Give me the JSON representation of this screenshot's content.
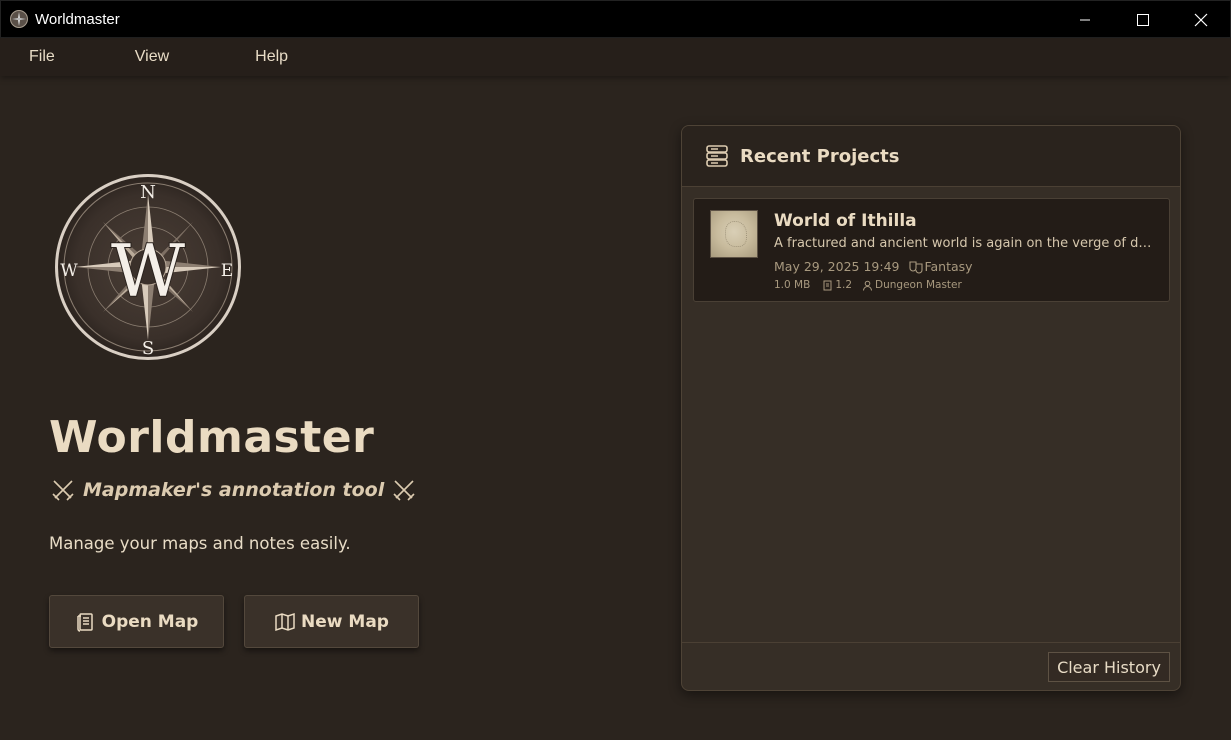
{
  "window": {
    "title": "Worldmaster",
    "icon": "compass-icon",
    "controls": [
      "minimize-icon",
      "maximize-icon",
      "close-icon"
    ]
  },
  "menu": {
    "items": [
      {
        "label": "File"
      },
      {
        "label": "View"
      },
      {
        "label": "Help"
      }
    ]
  },
  "hero": {
    "logo_icon": "compass-rose-icon",
    "compass_letters": {
      "n": "N",
      "s": "S",
      "e": "E",
      "w": "W",
      "center": "W"
    },
    "title": "Worldmaster",
    "tagline": "Mapmaker's annotation tool",
    "tagline_icon": "crossed-swords-icon",
    "description": "Manage your maps and notes easily.",
    "buttons": [
      {
        "label": "Open Map",
        "icon": "scroll-icon"
      },
      {
        "label": "New Map",
        "icon": "open-map-icon"
      }
    ]
  },
  "recent": {
    "title": "Recent Projects",
    "icon": "stacked-books-icon",
    "projects": [
      {
        "name": "World of Ithilla",
        "description": "A fractured and ancient world is again on the verge of destru...",
        "date": "May 29, 2025 19:49",
        "genre": "Fantasy",
        "size": "1.0 MB",
        "version": "1.2",
        "role": "Dungeon Master"
      }
    ],
    "clear_label": "Clear History"
  },
  "colors": {
    "background": "#2b241e",
    "panel": "#362e26",
    "text": "#e8dcc6",
    "muted": "#a8997f",
    "titlebar": "#000000"
  }
}
